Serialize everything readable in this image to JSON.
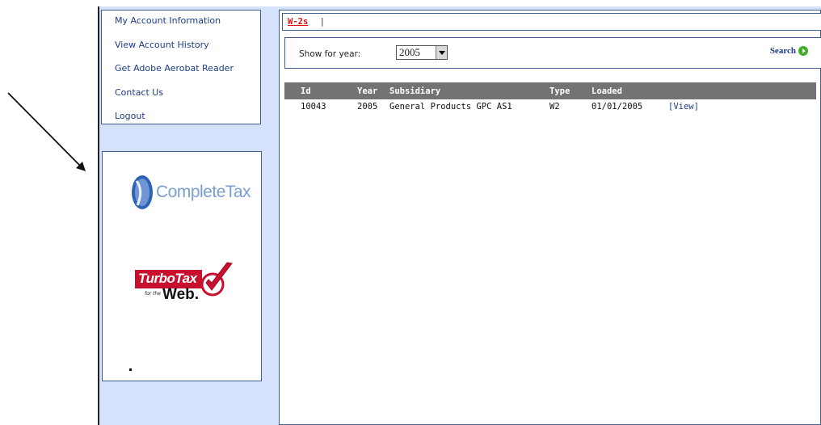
{
  "nav": {
    "items": [
      {
        "label": "My Account Information"
      },
      {
        "label": "View Account History"
      },
      {
        "label": "Get Adobe Aerobat Reader"
      },
      {
        "label": "Contact Us"
      },
      {
        "label": "Logout"
      }
    ]
  },
  "sponsors": {
    "completetax": "CompleteTax",
    "turbotax": "TurboTax",
    "turbotax_for": "for the",
    "turbotax_web": "Web."
  },
  "tabs": {
    "active": "W-2s",
    "separator": "|"
  },
  "filter": {
    "label": "Show for year:",
    "year": "2005",
    "search_label": "Search"
  },
  "table": {
    "headers": [
      "Id",
      "Year",
      "Subsidiary",
      "Type",
      "Loaded"
    ],
    "rows": [
      {
        "id": "10043",
        "year": "2005",
        "subsidiary": "General Products GPC AS1",
        "type": "W2",
        "loaded": "01/01/2005",
        "action": "[View]"
      }
    ]
  },
  "colors": {
    "page_bg": "#d6e1fb",
    "border": "#3f5e95",
    "header_bg": "#737373",
    "active_tab": "#dd1111",
    "link": "#1c3d86"
  },
  "icons": {
    "search": "play-circle-icon",
    "dropdown": "chevron-down-icon",
    "pointer": "arrow-icon"
  }
}
